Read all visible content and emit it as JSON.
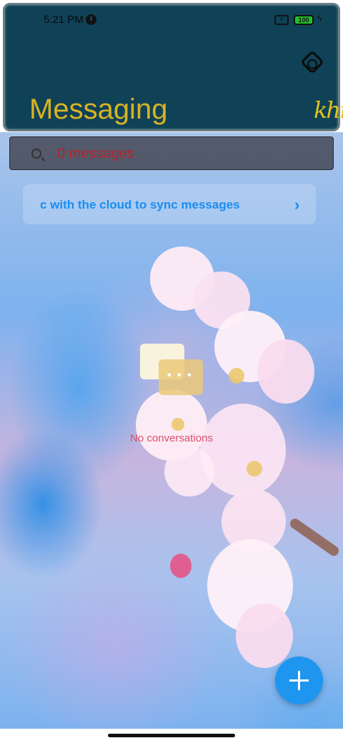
{
  "status_bar": {
    "time": "5:21 PM",
    "battery": "100"
  },
  "header": {
    "title": "Messaging",
    "logo_text": "khm"
  },
  "search": {
    "placeholder": "0 messages"
  },
  "sync_banner": {
    "text": "c with the cloud to sync messages",
    "chevron": "›"
  },
  "empty_state": {
    "text": "No conversations",
    "dots": "• • •"
  },
  "icons": {
    "settings": "gear-icon",
    "search": "search-icon",
    "compose": "plus-icon"
  },
  "colors": {
    "header_bg": "#0f4257",
    "title": "#d8b323",
    "accent": "#1e96f0",
    "search_placeholder": "#b2262a",
    "empty_text": "#d8526a"
  }
}
